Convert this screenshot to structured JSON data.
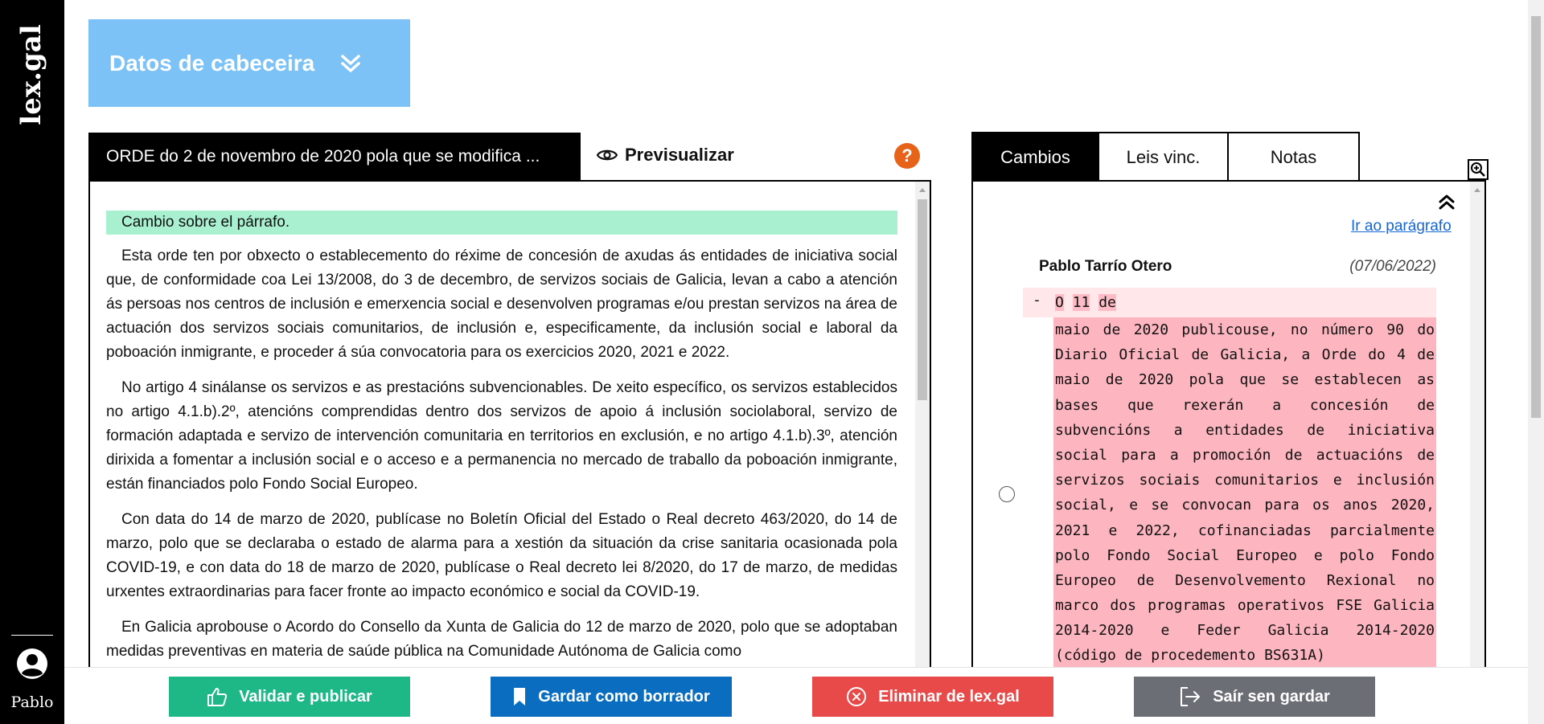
{
  "sidebar": {
    "logo_text": "lex.gal",
    "user_name": "Pablo"
  },
  "header": {
    "title": "Datos de cabeceira"
  },
  "document": {
    "tab_title": "ORDE do 2 de novembro de 2020 pola que se modifica ...",
    "preview_label": "Previsualizar",
    "help_label": "?",
    "change_note": "Cambio sobre el párrafo.",
    "paragraphs": [
      "Esta orde ten por obxecto o establecemento do réxime de concesión de axudas ás entidades de iniciativa social que, de conformidade coa Lei 13/2008, do 3 de decembro, de servizos sociais de Galicia, levan a cabo a atención ás persoas nos centros de inclusión e emerxencia social e desenvolven programas e/ou prestan servizos na área de actuación dos servizos sociais comunitarios, de inclusión e, especificamente, da inclusión social e laboral da poboación inmigrante, e proceder á súa convocatoria para os exercicios 2020, 2021 e 2022.",
      "No artigo 4 sinálanse os servizos e as prestacións subvencionables. De xeito específico, os servizos establecidos no artigo 4.1.b).2º, atencións comprendidas dentro dos servizos de apoio á inclusión sociolaboral, servizo de formación adaptada e servizo de intervención comunitaria en territorios en exclusión, e no artigo 4.1.b).3º, atención dirixida a fomentar a inclusión social e o acceso e a permanencia no mercado de traballo da poboación inmigrante, están financiados polo Fondo Social Europeo.",
      "Con data do 14 de marzo de 2020, publícase no Boletín Oficial del Estado o Real decreto 463/2020, do 14 de marzo, polo que se declaraba o estado de alarma para a xestión da situación da crise sanitaria ocasionada pola COVID-19, e con data do 18 de marzo de 2020, publícase o Real decreto lei 8/2020, do 17 de marzo, de medidas urxentes extraordinarias para facer fronte ao impacto económico e social da COVID-19.",
      "En Galicia aprobouse o Acordo do Consello da Xunta de Galicia do 12 de marzo de 2020, polo que se adoptaban medidas preventivas en materia de saúde pública na Comunidade Autónoma de Galicia como"
    ]
  },
  "right_panel": {
    "tabs": [
      {
        "label": "Cambios",
        "active": true
      },
      {
        "label": "Leis vinc.",
        "active": false
      },
      {
        "label": "Notas",
        "active": false
      }
    ],
    "goto_label": "Ir ao parágrafo",
    "change": {
      "author": "Pablo Tarrío Otero",
      "date": "(07/06/2022)",
      "diff_sign": "-",
      "head_words": [
        "O",
        "11",
        "de"
      ],
      "lines": [
        "maio de 2020 publicouse, no número 90 do",
        "Diario Oficial de Galicia, a Orde do 4 de",
        "maio de 2020 pola que se establecen as",
        "bases que rexerán a concesión de",
        "subvencións a entidades de iniciativa",
        "social para a promoción de actuacións de",
        "servizos sociais comunitarios e inclusión",
        "social, e se convocan para os anos 2020,",
        "2021 e 2022, cofinanciadas parcialmente",
        "polo Fondo Social Europeo e polo Fondo",
        "Europeo de Desenvolvemento Rexional no",
        "marco dos programas operativos FSE Galicia",
        "2014-2020 e Feder Galicia 2014-2020",
        "(código de procedemento BS631A)"
      ]
    }
  },
  "actions": {
    "validate_label": "Validar e publicar",
    "draft_label": "Gardar como borrador",
    "delete_label": "Eliminar de lex.gal",
    "exit_label": "Saír sen gardar"
  },
  "colors": {
    "header_bg": "#7cc2f7",
    "help_orange": "#e8631a",
    "change_note_bg": "#a8f0d0",
    "diff_removed_bg": "#fdb6c0",
    "validate_green": "#1db886",
    "draft_blue": "#0a6dc0",
    "delete_red": "#e84a4a",
    "exit_gray": "#6b6e74",
    "link_blue": "#1366d6"
  }
}
